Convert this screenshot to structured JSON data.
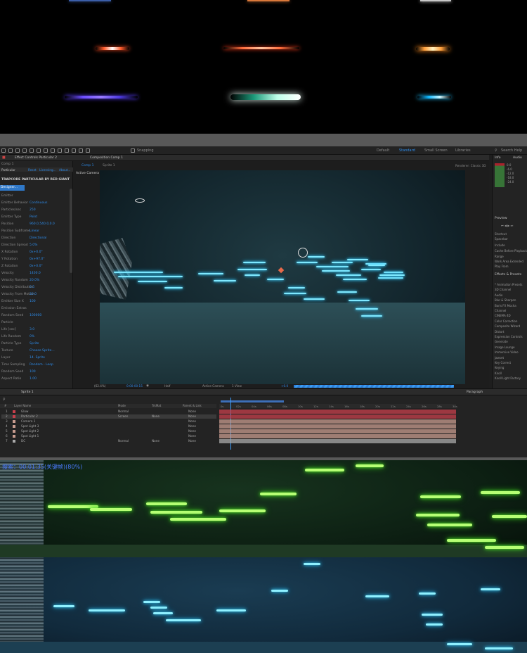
{
  "ae": {
    "workspaces": [
      "Default",
      "Standard",
      "Small Screen",
      "Libraries"
    ],
    "active_workspace": "Standard",
    "search_help": "Search Help",
    "snapping": "Snapping",
    "fx_panel": {
      "tab": "Effect Controls Particular 2",
      "comp_label": "Comp 1",
      "effect_name": "Particular",
      "plugin_title": "TRAPCODE PARTICULAR BY RED GIANT",
      "designer_button": "Designer...",
      "rows": [
        {
          "label": "Emitter",
          "value": ""
        },
        {
          "label": "Emitter Behavior",
          "value": "Continuous"
        },
        {
          "label": "Particles/sec",
          "value": "250"
        },
        {
          "label": "Emitter Type",
          "value": "Point"
        },
        {
          "label": "Position",
          "value": "960.0,540.0,0.0"
        },
        {
          "label": "Position Subframe",
          "value": "Linear"
        },
        {
          "label": "Direction",
          "value": "Directional"
        },
        {
          "label": "Direction Spread",
          "value": "5.0%"
        },
        {
          "label": "X Rotation",
          "value": "0x+0.0°"
        },
        {
          "label": "Y Rotation",
          "value": "0x+97.0°"
        },
        {
          "label": "Z Rotation",
          "value": "0x+0.0°"
        },
        {
          "label": "Velocity",
          "value": "1400.0"
        },
        {
          "label": "Velocity Random",
          "value": "20.0%"
        },
        {
          "label": "Velocity Distribution",
          "value": "0.5"
        },
        {
          "label": "Velocity From Motion",
          "value": "20.0"
        },
        {
          "label": "Emitter Size X",
          "value": "100"
        },
        {
          "label": "Emission Extras",
          "value": ""
        },
        {
          "label": "Random Seed",
          "value": "100000"
        },
        {
          "label": "Particle",
          "value": ""
        },
        {
          "label": "Life [sec]",
          "value": "3.0"
        },
        {
          "label": "Life Random",
          "value": "0%"
        },
        {
          "label": "Particle Type",
          "value": "Sprite"
        },
        {
          "label": "Texture",
          "value": "Choose Sprite..."
        },
        {
          "label": "Layer",
          "value": "14. Sprite"
        },
        {
          "label": "Time Sampling",
          "value": "Random - Loop"
        },
        {
          "label": "Random Seed",
          "value": "100"
        },
        {
          "label": "Aspect Ratio",
          "value": "1.00"
        }
      ]
    },
    "comp_panel": {
      "tab": "Composition Comp 1",
      "breadcrumbs": [
        "Comp 1",
        "Sprite 1"
      ],
      "renderer": "Renderer: Classic 3D",
      "view_label": "Active Camera",
      "zoom": "(62.4%)",
      "timecode": "0:00:00:15",
      "resolution": "Half",
      "camera": "Active Camera",
      "views": "1 View",
      "exposure": "+0.0"
    },
    "right_panel": {
      "sections": [
        "Info",
        "Audio",
        "Preview",
        "Shortcut",
        "Spacebar",
        "Include",
        "Cache Before Playback",
        "Range",
        "Work Area Extended",
        "Play From",
        "Effects & Presets"
      ],
      "effects": [
        "* Animation Presets",
        "3D Channel",
        "Audio",
        "Blur & Sharpen",
        "Boris FX Mocha",
        "Channel",
        "CINEMA 4D",
        "Color Correction",
        "Composite Wizard",
        "Distort",
        "Expression Controls",
        "Generate",
        "Image Lounge",
        "Immersive Video",
        "Jawset",
        "Key Correct",
        "Keying",
        "Knoll",
        "Knoll Light Factory"
      ],
      "audio_levels": [
        "0.0",
        "-6.0",
        "-12.0",
        "-18.0",
        "-24.0"
      ]
    },
    "timeline": {
      "tabs": [
        "Comp 1",
        "Sprite 1"
      ],
      "timecode": "0:00:00:15",
      "columns": [
        "#",
        "Layer Name",
        "Mode",
        "TrkMat",
        "Parent & Link"
      ],
      "layers": [
        {
          "num": "1",
          "name": "Glow",
          "mode": "Normal",
          "trkmat": "",
          "parent": "None",
          "color": "#c7404c"
        },
        {
          "num": "2",
          "name": "Particular 2",
          "mode": "Screen",
          "trkmat": "None",
          "parent": "None",
          "color": "#c7404c"
        },
        {
          "num": "3",
          "name": "Camera 1",
          "mode": "",
          "trkmat": "",
          "parent": "None",
          "color": "#c89c8f"
        },
        {
          "num": "4",
          "name": "Spot Light 3",
          "mode": "",
          "trkmat": "",
          "parent": "None",
          "color": "#c89c8f"
        },
        {
          "num": "5",
          "name": "Spot Light 2",
          "mode": "",
          "trkmat": "",
          "parent": "None",
          "color": "#c89c8f"
        },
        {
          "num": "6",
          "name": "Spot Light 1",
          "mode": "",
          "trkmat": "",
          "parent": "None",
          "color": "#c89c8f"
        },
        {
          "num": "7",
          "name": "DC",
          "mode": "Normal",
          "trkmat": "None",
          "parent": "None",
          "color": "#a9a9a9"
        }
      ],
      "ruler": [
        "0s",
        "02s",
        "04s",
        "06s",
        "08s",
        "10s",
        "12s",
        "14s",
        "16s",
        "18s",
        "20s",
        "22s",
        "24s",
        "26s",
        "28s",
        "30s"
      ],
      "paragraph_tab": "Paragraph"
    }
  },
  "green_panel": {
    "overlay_text": "搜索：00:01:35(关键帧)(80%)"
  }
}
